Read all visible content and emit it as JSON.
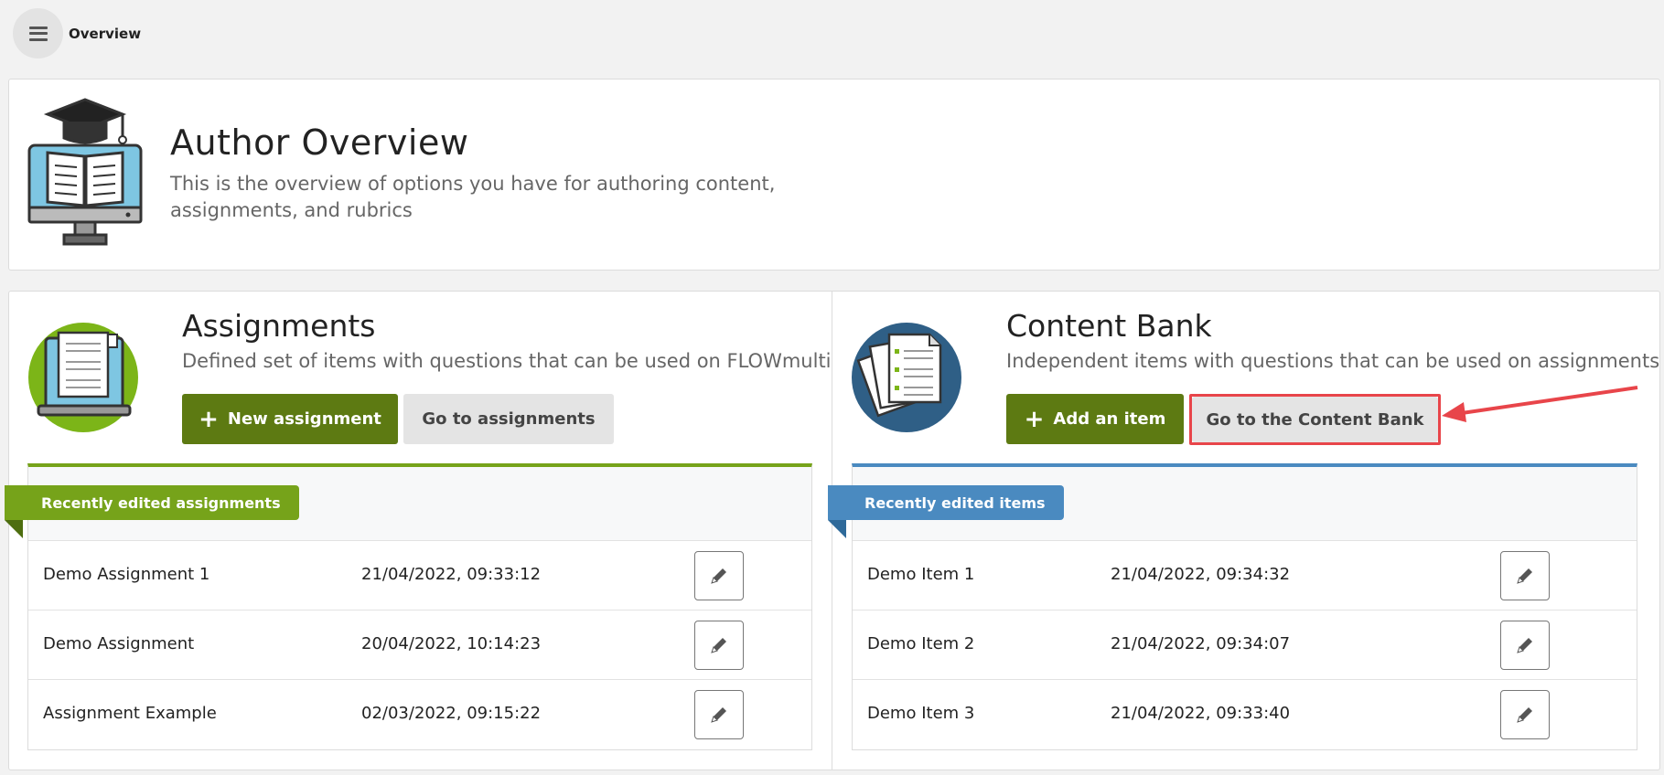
{
  "topbar": {
    "breadcrumb": "Overview"
  },
  "header": {
    "title": "Author Overview",
    "description": "This is the overview of options you have for authoring content, assignments, and rubrics"
  },
  "assignments": {
    "title": "Assignments",
    "description": "Defined set of items with questions that can be used on FLOWmulti",
    "primary_button": "New assignment",
    "secondary_button": "Go to assignments",
    "ribbon": "Recently edited assignments",
    "accent": "#76a31a",
    "rows": [
      {
        "name": "Demo Assignment 1",
        "date": "21/04/2022, 09:33:12"
      },
      {
        "name": "Demo Assignment",
        "date": "20/04/2022, 10:14:23"
      },
      {
        "name": "Assignment Example",
        "date": "02/03/2022, 09:15:22"
      }
    ]
  },
  "content_bank": {
    "title": "Content Bank",
    "description": "Independent items with questions that can be used on assignments",
    "primary_button": "Add an item",
    "secondary_button": "Go to the Content Bank",
    "ribbon": "Recently edited items",
    "accent": "#4a8ac0",
    "rows": [
      {
        "name": "Demo Item 1",
        "date": "21/04/2022, 09:34:32"
      },
      {
        "name": "Demo Item 2",
        "date": "21/04/2022, 09:34:07"
      },
      {
        "name": "Demo Item 3",
        "date": "21/04/2022, 09:33:40"
      }
    ]
  },
  "colors": {
    "primary_green": "#5d7a12",
    "annotation_red": "#e8454a"
  },
  "icons": {
    "menu": "hamburger-icon",
    "edit": "pencil-icon",
    "plus": "plus-icon"
  }
}
